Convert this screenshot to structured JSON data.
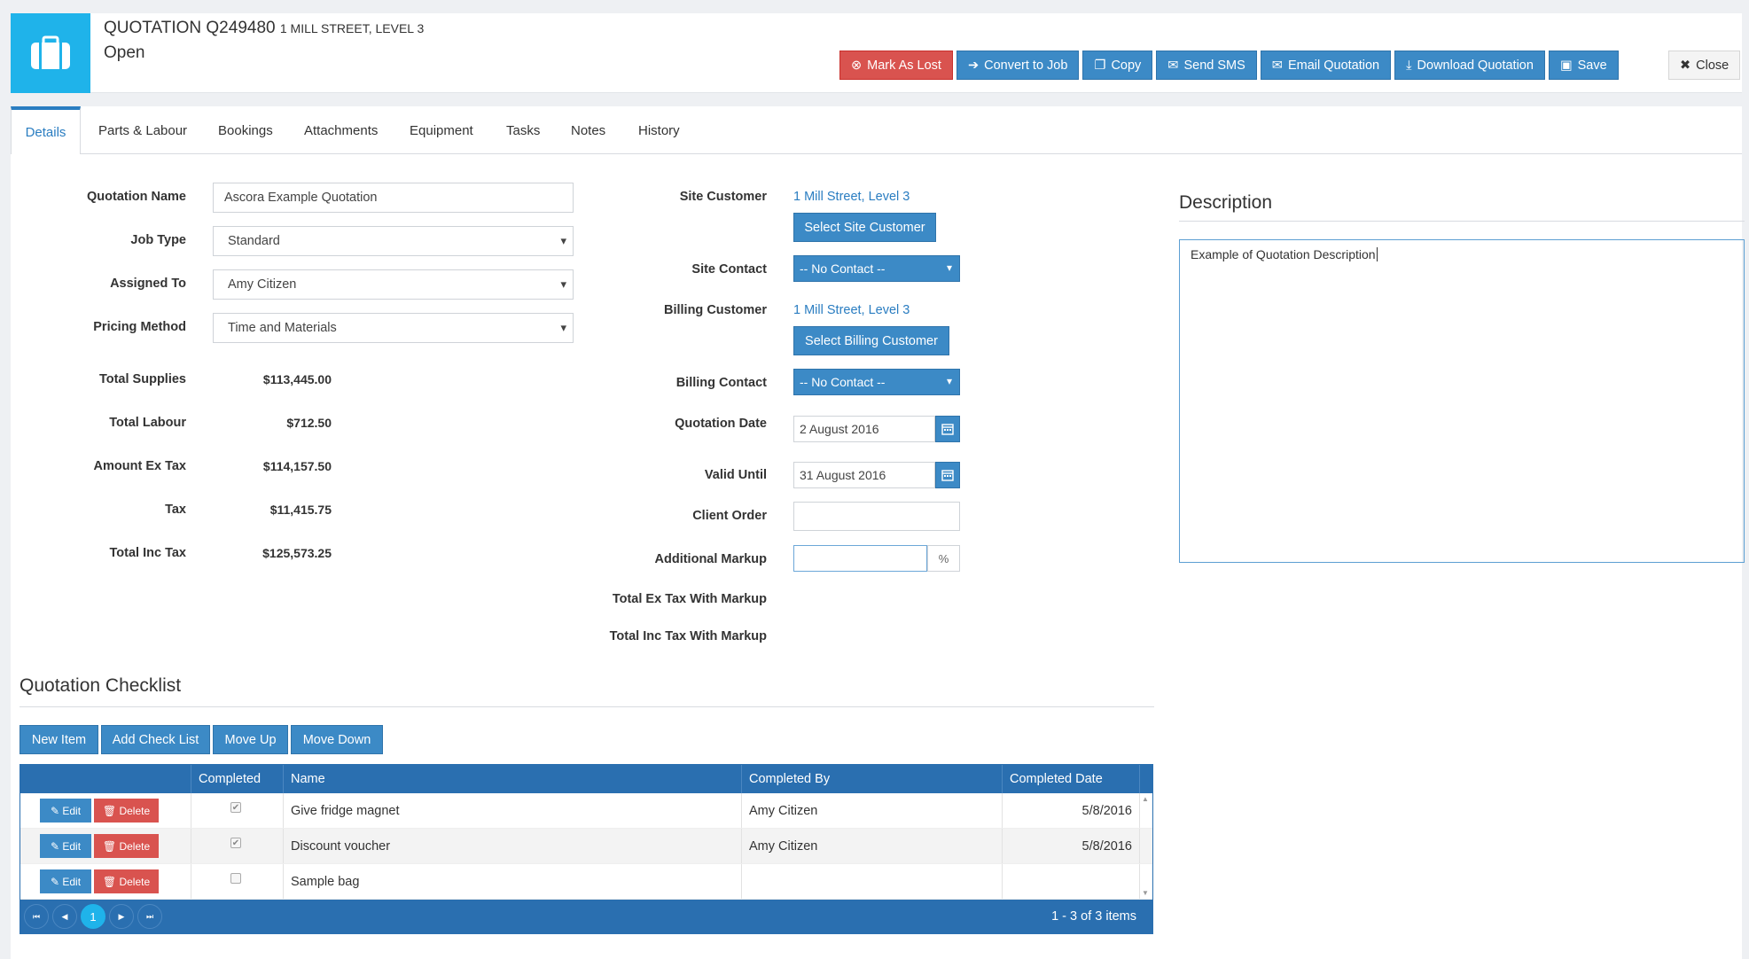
{
  "header": {
    "title": "QUOTATION Q249480",
    "address": "1 MILL STREET, LEVEL 3",
    "status": "Open",
    "buttons": {
      "mark_lost": "Mark As Lost",
      "convert": "Convert to Job",
      "copy": "Copy",
      "sms": "Send SMS",
      "email": "Email Quotation",
      "download": "Download Quotation",
      "save": "Save",
      "close": "Close"
    }
  },
  "tabs": [
    "Details",
    "Parts & Labour",
    "Bookings",
    "Attachments",
    "Equipment",
    "Tasks",
    "Notes",
    "History"
  ],
  "form": {
    "quotation_name_label": "Quotation Name",
    "quotation_name": "Ascora Example Quotation",
    "job_type_label": "Job Type",
    "job_type": "Standard",
    "assigned_to_label": "Assigned To",
    "assigned_to": "Amy Citizen",
    "pricing_method_label": "Pricing Method",
    "pricing_method": "Time and Materials",
    "total_supplies_label": "Total Supplies",
    "total_supplies": "$113,445.00",
    "total_labour_label": "Total Labour",
    "total_labour": "$712.50",
    "amount_ex_tax_label": "Amount Ex Tax",
    "amount_ex_tax": "$114,157.50",
    "tax_label": "Tax",
    "tax": "$11,415.75",
    "total_inc_tax_label": "Total Inc Tax",
    "total_inc_tax": "$125,573.25",
    "site_customer_label": "Site Customer",
    "site_customer": "1 Mill Street, Level 3",
    "select_site_customer": "Select Site Customer",
    "site_contact_label": "Site Contact",
    "site_contact": "-- No Contact --",
    "billing_customer_label": "Billing Customer",
    "billing_customer": "1 Mill Street, Level 3",
    "select_billing_customer": "Select Billing Customer",
    "billing_contact_label": "Billing Contact",
    "billing_contact": "-- No Contact --",
    "quotation_date_label": "Quotation Date",
    "quotation_date": "2 August 2016",
    "valid_until_label": "Valid Until",
    "valid_until": "31 August 2016",
    "client_order_label": "Client Order",
    "client_order": "",
    "additional_markup_label": "Additional Markup",
    "additional_markup": "",
    "percent": "%",
    "total_ex_tax_markup_label": "Total Ex Tax With Markup",
    "total_inc_tax_markup_label": "Total Inc Tax With Markup"
  },
  "description": {
    "title": "Description",
    "text": "Example of Quotation Description"
  },
  "checklist": {
    "title": "Quotation Checklist",
    "buttons": [
      "New Item",
      "Add Check List",
      "Move Up",
      "Move Down"
    ],
    "columns": [
      "",
      "Completed",
      "Name",
      "Completed By",
      "Completed Date"
    ],
    "edit_label": "Edit",
    "delete_label": "Delete",
    "rows": [
      {
        "completed": true,
        "name": "Give fridge magnet",
        "completed_by": "Amy Citizen",
        "date": "5/8/2016"
      },
      {
        "completed": true,
        "name": "Discount voucher",
        "completed_by": "Amy Citizen",
        "date": "5/8/2016"
      },
      {
        "completed": false,
        "name": "Sample bag",
        "completed_by": "",
        "date": ""
      }
    ],
    "page": "1",
    "summary": "1 - 3 of 3 items"
  },
  "colors": {
    "primary": "#3c8ac6",
    "danger": "#d9534f",
    "accent": "#1fb3ea",
    "grid_header": "#2a6fb0"
  }
}
